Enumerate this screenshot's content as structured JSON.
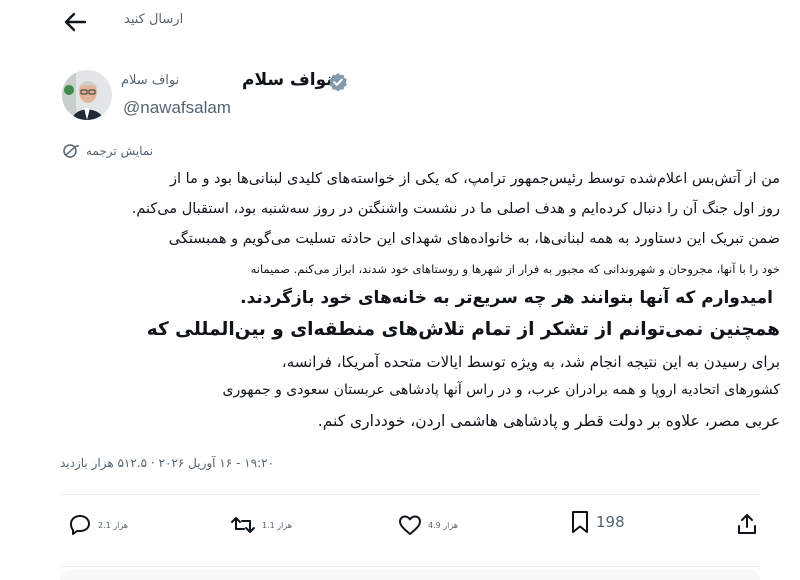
{
  "topbar": {
    "title": "ارسال کنید"
  },
  "author": {
    "name": "نواف سلام",
    "secondary_name": "نواف سلام",
    "handle": "@nawafsalam"
  },
  "translate": {
    "label": "نمایش ترجمه"
  },
  "post": {
    "lines": [
      "من از آتش‌بس اعلام‌شده توسط رئیس‌جمهور ترامپ، که یکی از خواسته‌های کلیدی لبنانی‌ها بود و ما از",
      "روز اول جنگ آن را دنبال کرده‌ایم و هدف اصلی ما در نشست واشنگتن در روز سه‌شنبه بود، استقبال می‌کنم.",
      "ضمن تبریک این دستاورد به همه لبنانی‌ها، به خانواده‌های شهدای این حادثه تسلیت می‌گویم و همبستگی",
      "خود را با آنها، مجروحان و شهروندانی که مجبور به فرار از شهرها و روستاهای خود شدند، ابراز می‌کنم. صمیمانه",
      "امیدوارم که آنها بتوانند هر چه سریع‌تر به خانه‌های خود بازگردند.",
      "همچنین نمی‌توانم از تشکر از تمام تلاش‌های منطقه‌ای و بین‌المللی که",
      "برای رسیدن به این نتیجه انجام شد، به ویژه توسط ایالات متحده آمریکا، فرانسه،",
      "کشورهای اتحادیه اروپا و همه برادران عرب، و در راس آنها پادشاهی عربستان سعودی و جمهوری",
      "عربی مصر، علاوه بر دولت قطر و پادشاهی هاشمی اردن، خودداری کنم."
    ]
  },
  "meta": {
    "text": "۱۹:۲۰ - ۱۶ آوریل ۲۰۲۶ · ۵۱۲.۵ هزار بازدید"
  },
  "actions": {
    "replies": "2.1 هزار",
    "reposts": "1.1 هزار",
    "likes": "4.9 هزار",
    "bookmarks": "198"
  },
  "colors": {
    "text": "#0f1419",
    "secondary": "#536471",
    "verified": "#829aab",
    "divider": "#e6ecf0"
  }
}
